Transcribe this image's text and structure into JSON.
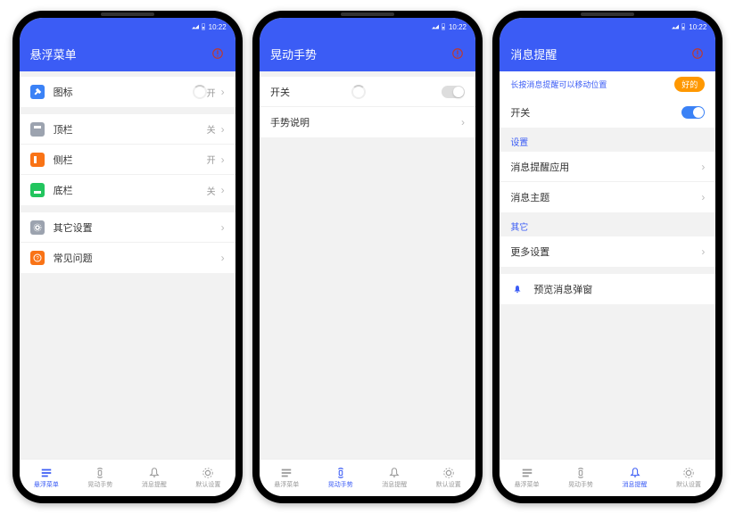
{
  "status_bar": {
    "time": "10:22"
  },
  "phones": [
    {
      "title": "悬浮菜单",
      "sections": [
        {
          "rows": [
            {
              "icon": "pin",
              "icon_bg": "#3b82f6",
              "label": "图标",
              "loading": true,
              "value": "开",
              "chevron": true
            }
          ]
        },
        {
          "rows": [
            {
              "icon": "top-bar",
              "icon_bg": "#9ca3af",
              "label": "顶栏",
              "value": "关",
              "chevron": true
            },
            {
              "icon": "side-bar",
              "icon_bg": "#f97316",
              "label": "侧栏",
              "value": "开",
              "chevron": true
            },
            {
              "icon": "bottom-bar",
              "icon_bg": "#22c55e",
              "label": "底栏",
              "value": "关",
              "chevron": true
            }
          ]
        },
        {
          "rows": [
            {
              "icon": "gear",
              "icon_bg": "#9ca3af",
              "label": "其它设置",
              "chevron": true
            },
            {
              "icon": "help",
              "icon_bg": "#f97316",
              "label": "常见问题",
              "chevron": true
            }
          ]
        }
      ],
      "active_tab": 0
    },
    {
      "title": "晃动手势",
      "sections": [
        {
          "rows": [
            {
              "label": "开关",
              "loading": true,
              "toggle": "off"
            },
            {
              "label": "手势说明",
              "chevron": true
            }
          ]
        }
      ],
      "active_tab": 1
    },
    {
      "title": "消息提醒",
      "tip": {
        "text": "长按消息提醒可以移动位置",
        "badge": "好的"
      },
      "groups": [
        {
          "rows": [
            {
              "label": "开关",
              "toggle": "on"
            }
          ]
        },
        {
          "header": "设置",
          "rows": [
            {
              "label": "消息提醒应用",
              "chevron": true
            },
            {
              "label": "消息主题",
              "chevron": true
            }
          ]
        },
        {
          "header": "其它",
          "rows": [
            {
              "label": "更多设置",
              "chevron": true
            }
          ]
        },
        {
          "rows": [
            {
              "icon": "bell",
              "icon_bg": "transparent",
              "icon_color": "#3b5cf5",
              "label": "预览消息弹窗"
            }
          ]
        }
      ],
      "active_tab": 2
    }
  ],
  "bottom_nav": [
    {
      "label": "悬浮菜单",
      "icon": "menu"
    },
    {
      "label": "晃动手势",
      "icon": "shake"
    },
    {
      "label": "消息提醒",
      "icon": "bell"
    },
    {
      "label": "默认设置",
      "icon": "gear"
    }
  ]
}
